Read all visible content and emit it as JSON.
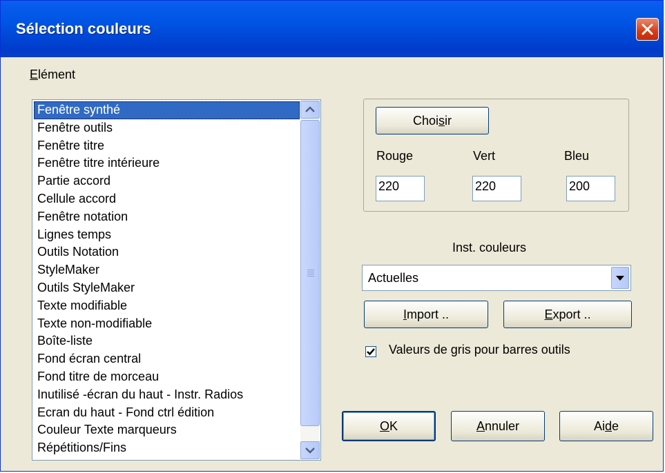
{
  "window": {
    "title": "Sélection couleurs"
  },
  "element_label": "Elément",
  "element_list": {
    "items": [
      "Fenêtre synthé",
      "Fenêtre outils",
      "Fenêtre titre",
      "Fenêtre titre intérieure",
      "Partie accord",
      "Cellule accord",
      "Fenêtre notation",
      "Lignes temps",
      "Outils Notation",
      "StyleMaker",
      "Outils StyleMaker",
      "Texte modifiable",
      "Texte non-modifiable",
      "Boîte-liste",
      "Fond écran central",
      "Fond titre de morceau",
      "Inutilisé -écran du haut - Instr. Radios",
      "Ecran du haut - Fond ctrl édition",
      "Couleur Texte marqueurs",
      "Répétitions/Fins"
    ],
    "selected_index": 0
  },
  "color_box": {
    "choose_button": "Choisir",
    "red_label": "Rouge",
    "green_label": "Vert",
    "blue_label": "Bleu",
    "red_value": "220",
    "green_value": "220",
    "blue_value": "200"
  },
  "color_sets": {
    "label": "Inst. couleurs",
    "selected": "Actuelles",
    "import_button": "Import ..",
    "export_button": "Export .."
  },
  "gray_toolbars": {
    "label": "Valeurs de gris pour barres outils",
    "checked": true
  },
  "buttons": {
    "ok": "OK",
    "cancel": "Annuler",
    "help": "Aide"
  },
  "icons": {
    "close": "close-icon",
    "scroll_up": "chevron-up-icon",
    "scroll_down": "chevron-down-icon",
    "dropdown": "triangle-down-icon",
    "check": "checkmark-icon"
  },
  "colors": {
    "title_bar": "#0054e3",
    "dialog_background": "#ece9d8",
    "selection": "#316ac5",
    "close_button": "#d63c16"
  }
}
